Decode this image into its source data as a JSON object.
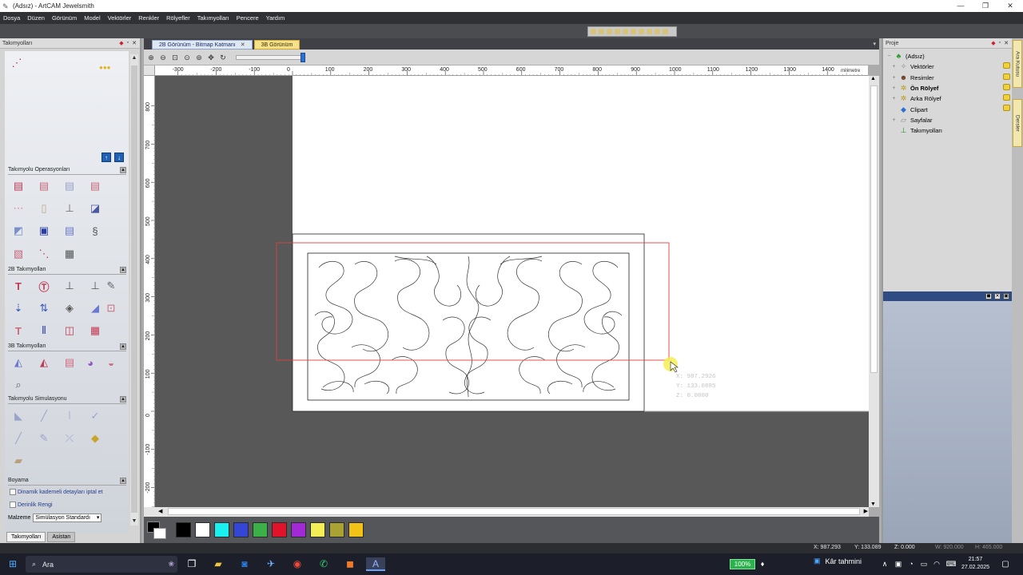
{
  "window": {
    "title": "(Adsız) - ArtCAM Jewelsmith",
    "minimize": "—",
    "restore": "❐",
    "close": "✕"
  },
  "menu": [
    "Dosya",
    "Düzen",
    "Görünüm",
    "Model",
    "Vektörler",
    "Renkler",
    "Rölyefler",
    "Takımyolları",
    "Pencere",
    "Yardım"
  ],
  "left_panel": {
    "title": "Takımyolları",
    "sections": {
      "ops": "Takımyolu Operasyonları",
      "2d": "2B Takımyolları",
      "3d": "3B Takımyolları",
      "sim": "Takımyolu Simulasyonu",
      "paint": "Boyama"
    },
    "checkboxes": [
      "Dinamik kademeli detayları iptal et",
      "Derinlik Rengi"
    ],
    "material_label": "Malzeme",
    "material_value": "Simülasyon Standardı",
    "tabs": [
      "Takımyolları",
      "Asistan"
    ]
  },
  "document_tabs": [
    "2B Görünüm - Bitmap Katmanı",
    "3B Görünüm"
  ],
  "ruler": {
    "unit": "milimetre",
    "h_ticks": [
      "-300",
      "-200",
      "-100",
      "0",
      "100",
      "200",
      "300",
      "400",
      "500",
      "600",
      "700",
      "800",
      "900",
      "1000",
      "1100",
      "1200",
      "1300",
      "1400"
    ],
    "v_ticks": [
      "800",
      "700",
      "600",
      "500",
      "400",
      "300",
      "200",
      "100",
      "0",
      "-100",
      "-200"
    ]
  },
  "cursor_readout": {
    "x": "X: 987.2926",
    "y": "Y: 133.0885",
    "z": "Z: 0.0000"
  },
  "palette": [
    "#000000",
    "#ffffff",
    "#19f0f0",
    "#3346d6",
    "#3cb048",
    "#e0132a",
    "#a12ad6",
    "#f5ee55",
    "#aaa333",
    "#f2c216"
  ],
  "right_panel": {
    "title": "Proje",
    "tree": [
      {
        "label": "(Adsız)",
        "bold": false
      },
      {
        "label": "Vektörler",
        "bold": false
      },
      {
        "label": "Resimler",
        "bold": false
      },
      {
        "label": "Ön Rölyef",
        "bold": true
      },
      {
        "label": "Arka Rölyef",
        "bold": false
      },
      {
        "label": "Clipart",
        "bold": false
      },
      {
        "label": "Sayfalar",
        "bold": false
      },
      {
        "label": "Takımyolları",
        "bold": false
      }
    ]
  },
  "side_tabs": [
    "Ara Kutusu",
    "Dersler"
  ],
  "status": {
    "x": "X: 987.293",
    "y": "Y: 133.089",
    "z": "Z: 0.000",
    "w": "W: 920.000",
    "h": "H: 465.000"
  },
  "taskbar": {
    "search": "Ara",
    "zoom": "100%",
    "weather": "Kâr tahmini",
    "time": "21:57",
    "date": "27.02.2025"
  }
}
